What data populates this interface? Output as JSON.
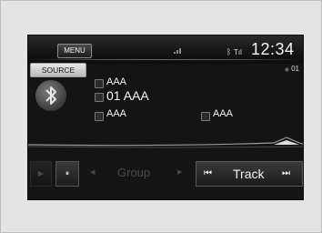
{
  "topbar": {
    "menu_label": "MENU",
    "time": "12:34",
    "bluetooth_icon": "bluetooth-icon",
    "signal_icon": "signal-strength-icon"
  },
  "source": {
    "label": "SOURCE"
  },
  "disc": {
    "number": "01",
    "icon": "disc-icon"
  },
  "track_info": {
    "line1": "AAA",
    "line2": "01 AAA",
    "line3": "AAA",
    "line4": "AAA",
    "line1_icon": "album-icon",
    "line2_icon": "music-note-icon",
    "line3_icon": "artist-icon",
    "line4_icon": "genre-icon"
  },
  "controls": {
    "play": "▶",
    "pause": "⏸",
    "group_label": "Group",
    "group_prev": "◀",
    "group_next": "▶",
    "track_label": "Track",
    "track_prev": "⏮",
    "track_next": "⏭"
  },
  "colors": {
    "screen_bg": "#141414",
    "accent_text": "#f2f2f2"
  }
}
